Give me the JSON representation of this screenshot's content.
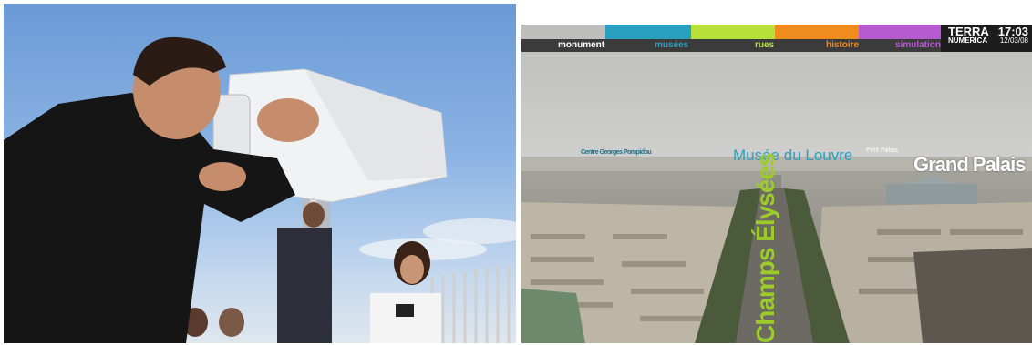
{
  "categories": [
    {
      "key": "monuments",
      "label": "monuments",
      "color": "#ffffff"
    },
    {
      "key": "musees",
      "label": "musées",
      "color": "#2aa0c0"
    },
    {
      "key": "rues",
      "label": "rues",
      "color": "#b8e03a"
    },
    {
      "key": "histoire",
      "label": "histoire",
      "color": "#f08c1e"
    },
    {
      "key": "simulations",
      "label": "simulations",
      "color": "#b65ad0"
    }
  ],
  "brand": {
    "line1": "TERRA",
    "line2": "NUMERICA"
  },
  "clock": {
    "time": "17:03",
    "date": "12/03/08"
  },
  "labels": {
    "pompidou": "Centre Georges Pompidou",
    "louvre": "Musée du Louvre",
    "small": "Petit Palais",
    "grand_palais": "Grand Palais",
    "champs": "Champs Élysées"
  },
  "colors": {
    "musees": "#2aa0c0",
    "rues": "#9ccc2a",
    "monuments": "#ffffff"
  }
}
